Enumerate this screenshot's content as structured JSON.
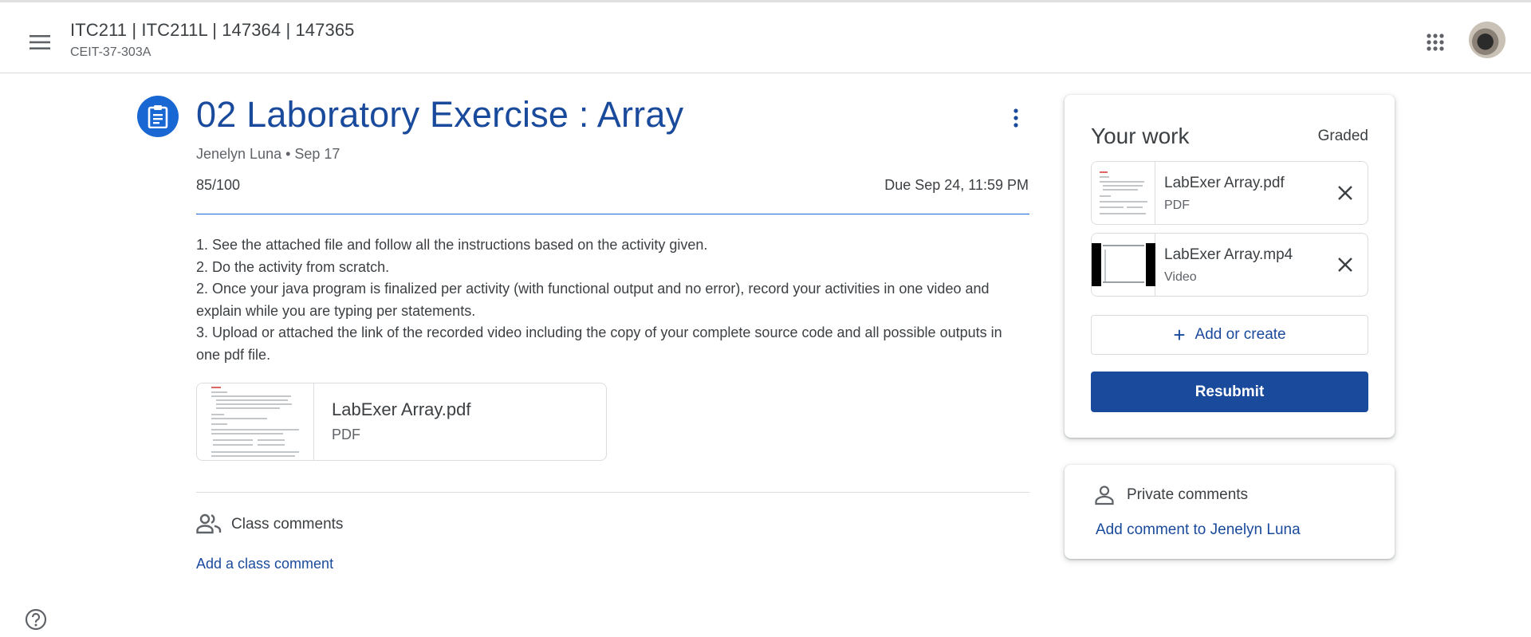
{
  "header": {
    "course_title": "ITC211 | ITC211L | 147364 | 147365",
    "section": "CEIT-37-303A",
    "menu_icon": "menu-icon",
    "apps_icon": "apps-grid-icon",
    "avatar": "user-avatar"
  },
  "assignment": {
    "icon": "assignment-icon",
    "title": "02 Laboratory Exercise : Array",
    "meta": "Jenelyn Luna • Sep 17",
    "points": "85/100",
    "due": "Due Sep 24, 11:59 PM",
    "instructions": [
      "1. See the attached file and follow all the instructions based on the activity given.",
      "2. Do the activity from scratch.",
      "2. Once your java program is finalized per activity (with functional output and no error), record your activities in one video and explain while you are typing per statements.",
      "3. Upload or attached the link of the recorded video including the copy of your complete source code and all possible outputs in one pdf file."
    ],
    "attachment": {
      "name": "LabExer Array.pdf",
      "type": "PDF"
    }
  },
  "class_comments": {
    "label": "Class comments",
    "add_link": "Add a class comment"
  },
  "your_work": {
    "title": "Your work",
    "status": "Graded",
    "files": [
      {
        "name": "LabExer Array.pdf",
        "type": "PDF"
      },
      {
        "name": "LabExer Array.mp4",
        "type": "Video"
      }
    ],
    "add_create": "Add or create",
    "resubmit": "Resubmit"
  },
  "private_comments": {
    "label": "Private comments",
    "add_link": "Add comment to Jenelyn Luna"
  },
  "colors": {
    "accent_blue": "#1a4a9c",
    "icon_blue": "#1967d2",
    "text": "#3c4043",
    "muted": "#5f6368"
  }
}
